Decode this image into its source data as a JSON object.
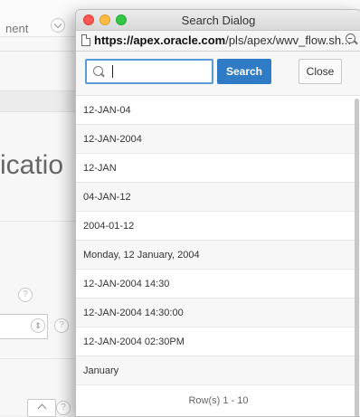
{
  "background_page": {
    "top_text": "nent",
    "heading_partial": "icatio"
  },
  "window": {
    "title": "Search Dialog",
    "url_bold": "https://apex.oracle.com",
    "url_rest": "/pls/apex/wwv_flow.sh..."
  },
  "search": {
    "placeholder": "",
    "value": "",
    "search_button_label": "Search",
    "close_button_label": "Close"
  },
  "results": [
    "12-JAN-04",
    "12-JAN-2004",
    "12-JAN",
    "04-JAN-12",
    "2004-01-12",
    "Monday, 12 January, 2004",
    "12-JAN-2004 14:30",
    "12-JAN-2004 14:30:00",
    "12-JAN-2004 02:30PM",
    "January"
  ],
  "pagination": "Row(s) 1 - 10",
  "colors": {
    "search_button": "#2f7bc6",
    "input_focus_border": "#5b9bd5"
  }
}
